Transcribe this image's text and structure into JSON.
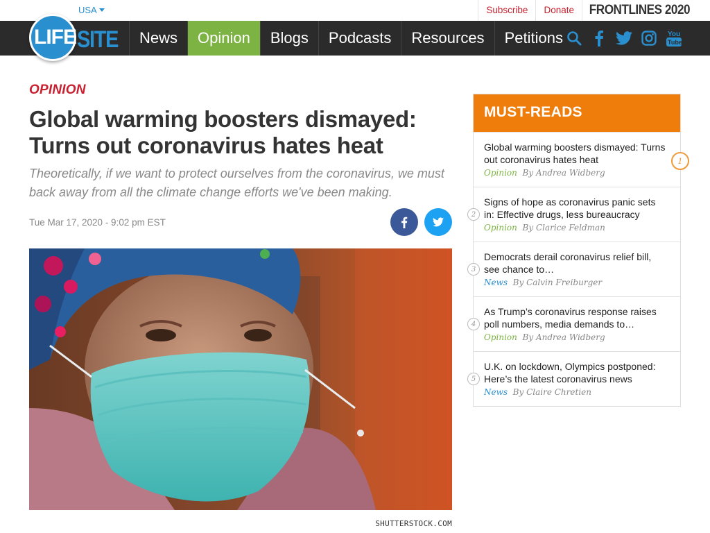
{
  "topbar": {
    "region": "USA",
    "subscribe": "Subscribe",
    "donate": "Donate",
    "frontlines": "FRONTLINES 2020"
  },
  "brand": {
    "life": "LIFE",
    "site": "SITE"
  },
  "nav": {
    "items": [
      {
        "label": "News",
        "active": false
      },
      {
        "label": "Opinion",
        "active": true
      },
      {
        "label": "Blogs",
        "active": false
      },
      {
        "label": "Podcasts",
        "active": false
      },
      {
        "label": "Resources",
        "active": false
      },
      {
        "label": "Petitions",
        "active": false
      }
    ],
    "icons": [
      "search-icon",
      "facebook-icon",
      "twitter-icon",
      "instagram-icon",
      "youtube-icon"
    ]
  },
  "article": {
    "section": "OPINION",
    "headline": "Global warming boosters dismayed: Turns out coronavirus hates heat",
    "dek": "Theoretically, if we want to protect ourselves from the coronavirus, we must back away from all the climate change efforts we've been making.",
    "date": "Tue Mar 17, 2020 - 9:02 pm EST",
    "image_credit": "SHUTTERSTOCK.COM"
  },
  "must_reads": {
    "title": "MUST-READS",
    "items": [
      {
        "num": "1",
        "title": "Global warming boosters dismayed: Turns out coronavirus hates heat",
        "category": "Opinion",
        "author": "By Andrea Widberg"
      },
      {
        "num": "2",
        "title": "Signs of hope as coronavirus panic sets in: Effective drugs, less bureaucracy",
        "category": "Opinion",
        "author": "By Clarice Feldman"
      },
      {
        "num": "3",
        "title": "Democrats derail coronavirus relief bill, see chance to…",
        "category": "News",
        "author": "By Calvin Freiburger"
      },
      {
        "num": "4",
        "title": "As Trump’s coronavirus response raises poll numbers, media demands to…",
        "category": "Opinion",
        "author": "By Andrea Widberg"
      },
      {
        "num": "5",
        "title": "U.K. on lockdown, Olympics postponed: Here’s the latest coronavirus news",
        "category": "News",
        "author": "By Claire Chretien"
      }
    ]
  },
  "colors": {
    "brand_blue": "#2a8fcf",
    "opinion_green": "#7cb342",
    "accent_red": "#c8202f",
    "must_orange": "#ee7d0b",
    "nav_bg": "#2b2b2b"
  }
}
